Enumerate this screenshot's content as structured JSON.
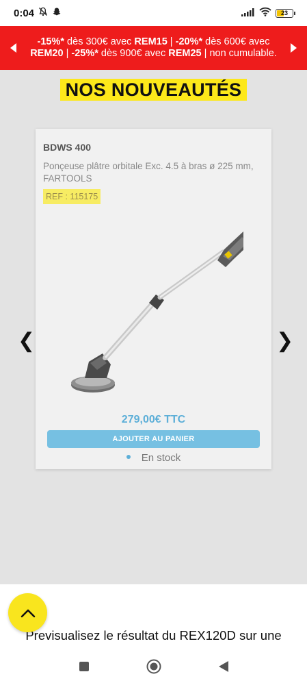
{
  "statusbar": {
    "time": "0:04",
    "battery_level": "23",
    "icons": [
      "mute-bell-icon",
      "snapchat-icon",
      "signal-icon",
      "wifi-icon",
      "battery-icon"
    ]
  },
  "promo": {
    "seg1_value": "-15%*",
    "seg1_text": " dès 300€ avec ",
    "seg1_code": "REM15",
    "sep1": " | ",
    "seg2_value": "-20%*",
    "seg2_text": " dès 600€ avec ",
    "seg2_code": "REM20",
    "sep2": "  | ",
    "seg3_value": "-25%*",
    "seg3_text": " dès 900€ avec ",
    "seg3_code": "REM25",
    "seg3_tail": " | non cumulable.",
    "colors": {
      "background": "#ee1c1c",
      "text": "#ffffff"
    }
  },
  "section": {
    "title": "NOS NOUVEAUTÉS",
    "highlight_color": "#fde81a"
  },
  "carousel": {
    "prev_icon": "chevron-left-icon",
    "next_icon": "chevron-right-icon",
    "prev_glyph": "❮",
    "next_glyph": "❯"
  },
  "product": {
    "model": "BDWS 400",
    "description": "Ponçeuse plâtre orbitale Exc. 4.5 à bras ø 225 mm, FARTOOLS",
    "ref": "REF : 115175",
    "image_icon": "drywall-sander-image",
    "price": "279,00€ TTC",
    "add_to_cart": "AJOUTER AU PANIER",
    "stock": "En stock",
    "colors": {
      "price": "#5dafd8",
      "button": "#76c0e2",
      "ref_bg": "#f7ec63"
    }
  },
  "bottom": {
    "preview_line1": "Previsualisez le résultat du REX120D sur une",
    "scroll_top_icon": "chevron-up-icon"
  },
  "navbar": {
    "icons": [
      "recents-square-icon",
      "home-circle-icon",
      "back-triangle-icon"
    ]
  }
}
